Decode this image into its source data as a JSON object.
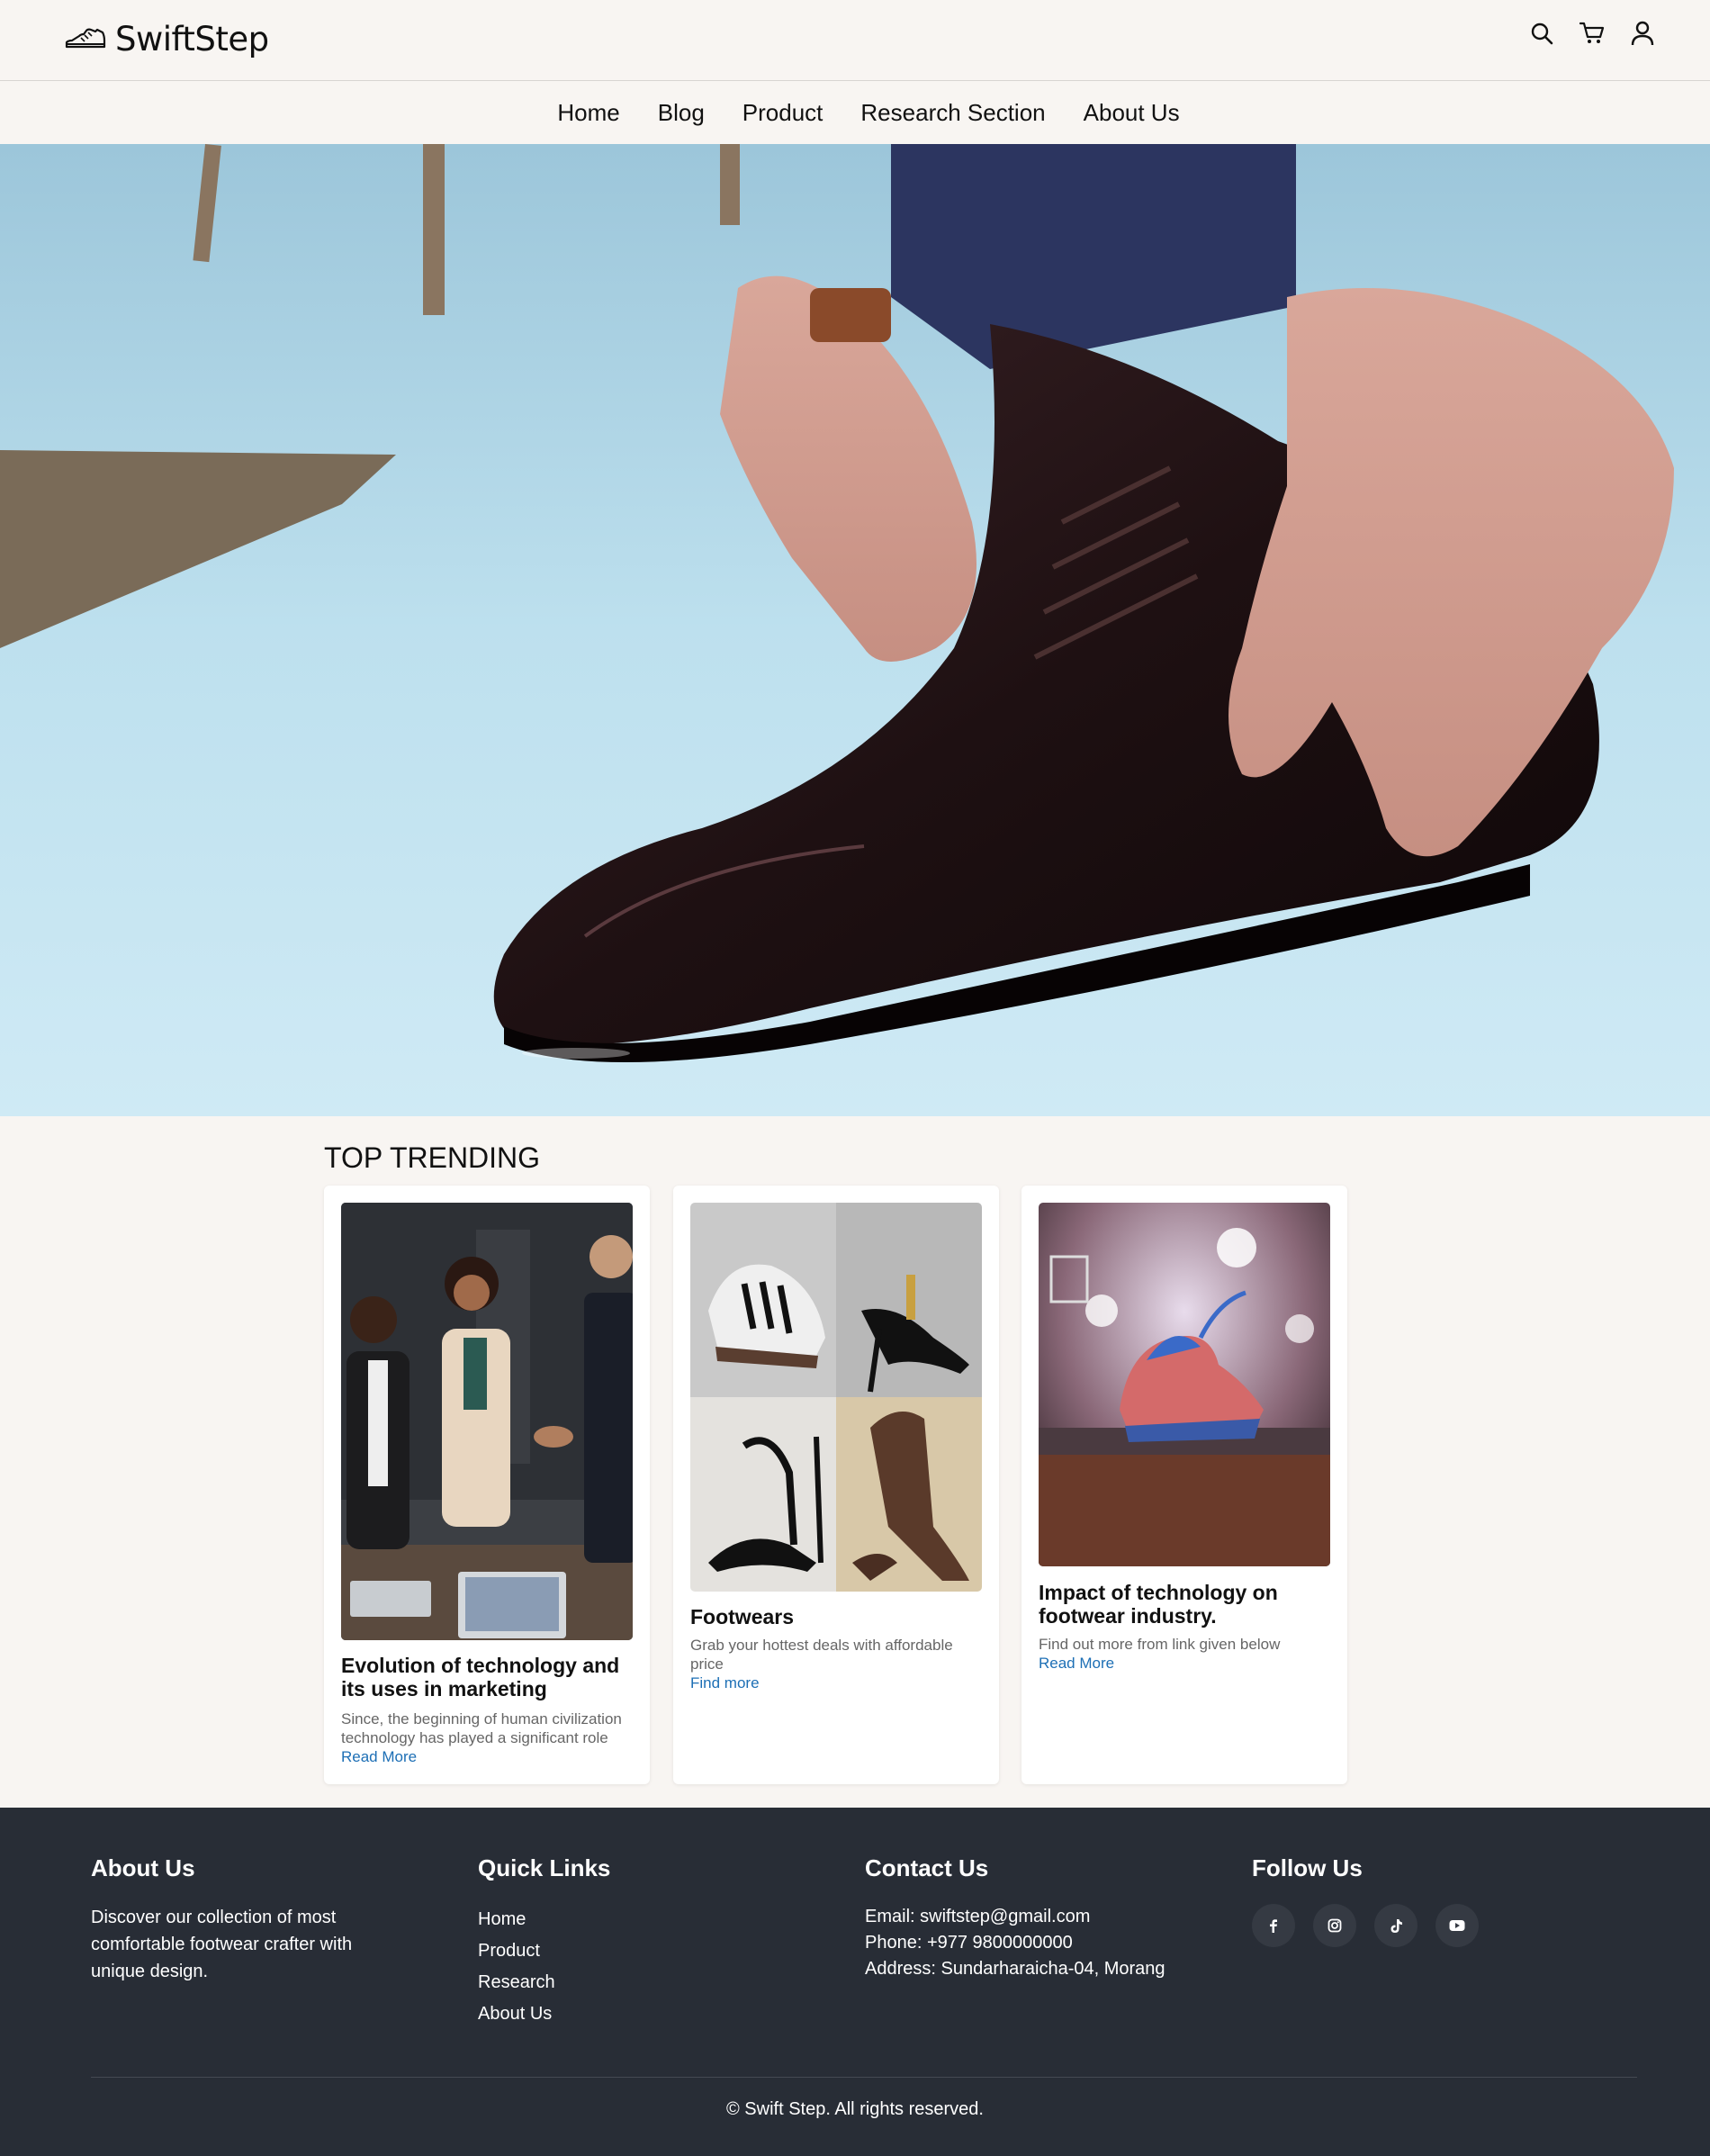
{
  "brand": {
    "name": "SwiftStep",
    "logo_icon": "shoe-icon"
  },
  "header_icons": [
    "search-icon",
    "cart-icon",
    "user-icon"
  ],
  "nav": {
    "items": [
      "Home",
      "Blog",
      "Product",
      "Research Section",
      "About Us"
    ]
  },
  "trending": {
    "title": "TOP TRENDING",
    "cards": [
      {
        "title": "Evolution of technology and its uses in marketing",
        "description": "Since, the beginning of human civilization technology has played a significant role",
        "link": "Read More"
      },
      {
        "title": "Footwears",
        "description": "Grab your hottest deals with affordable price",
        "link": "Find more"
      },
      {
        "title": "Impact of technology on footwear industry.",
        "description": "Find out more from link given below",
        "link": "Read More"
      }
    ]
  },
  "footer": {
    "about": {
      "heading": "About Us",
      "text": "Discover our collection of most comfortable footwear crafter with unique design."
    },
    "quick_links": {
      "heading": "Quick Links",
      "items": [
        "Home",
        "Product",
        "Research",
        "About Us"
      ]
    },
    "contact": {
      "heading": "Contact Us",
      "email": "Email: swiftstep@gmail.com",
      "phone": "Phone: +977 9800000000",
      "address": "Address: Sundarharaicha-04, Morang"
    },
    "follow": {
      "heading": "Follow Us",
      "icons": [
        "facebook-icon",
        "instagram-icon",
        "tiktok-icon",
        "youtube-icon"
      ]
    },
    "copyright": "© Swift Step. All rights reserved."
  },
  "colors": {
    "page_bg": "#f8f5f2",
    "footer_bg": "#282d36",
    "link": "#1d6fb5"
  }
}
